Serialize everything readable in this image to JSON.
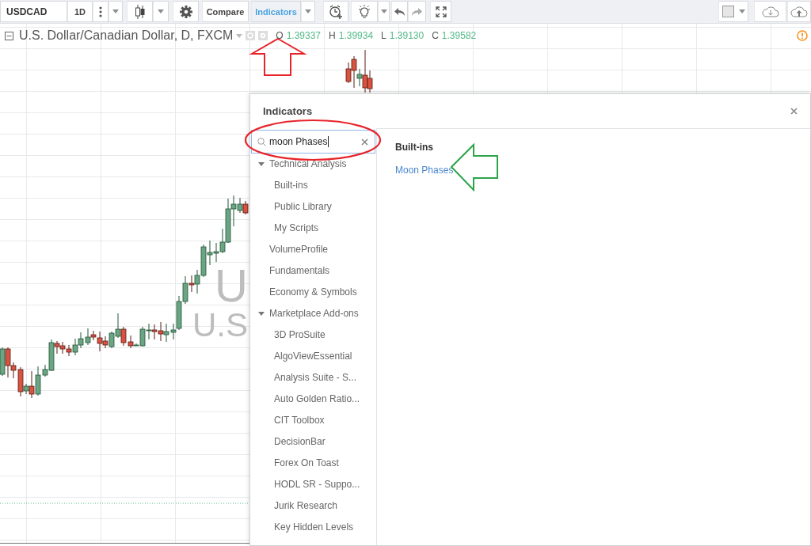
{
  "toolbar": {
    "symbol": "USDCAD",
    "interval": "1D",
    "compare": {
      "label": "Compare",
      "selected": false
    },
    "indicators": {
      "label": "Indicators",
      "selected": true
    }
  },
  "legend": {
    "title": "U.S. Dollar/Canadian Dollar, D, FXCM",
    "values": [
      {
        "key": "O",
        "value": "1.39337"
      },
      {
        "key": "H",
        "value": "1.39934"
      },
      {
        "key": "L",
        "value": "1.39130"
      },
      {
        "key": "C",
        "value": "1.39582"
      }
    ]
  },
  "watermark": [
    "U",
    "U.S"
  ],
  "indicators_dialog": {
    "title": "Indicators",
    "search": {
      "value": "moon Phases"
    },
    "categories": [
      {
        "label": "Technical Analysis",
        "kind": "group",
        "expanded": true,
        "children": [
          {
            "label": "Built-ins"
          },
          {
            "label": "Public Library"
          },
          {
            "label": "My Scripts"
          }
        ]
      },
      {
        "label": "VolumeProfile",
        "kind": "item"
      },
      {
        "label": "Fundamentals",
        "kind": "item"
      },
      {
        "label": "Economy & Symbols",
        "kind": "item"
      },
      {
        "label": "Marketplace Add-ons",
        "kind": "group",
        "expanded": true,
        "children": [
          {
            "label": "3D ProSuite"
          },
          {
            "label": "AlgoViewEssential"
          },
          {
            "label": "Analysis Suite - S..."
          },
          {
            "label": "Auto Golden Ratio..."
          },
          {
            "label": "CIT Toolbox"
          },
          {
            "label": "DecisionBar"
          },
          {
            "label": "Forex On Toast"
          },
          {
            "label": "HODL SR - Suppo..."
          },
          {
            "label": "Jurik Research"
          },
          {
            "label": "Key Hidden Levels"
          }
        ]
      }
    ],
    "results": {
      "heading": "Built-ins",
      "items": [
        "Moon Phases"
      ]
    }
  }
}
